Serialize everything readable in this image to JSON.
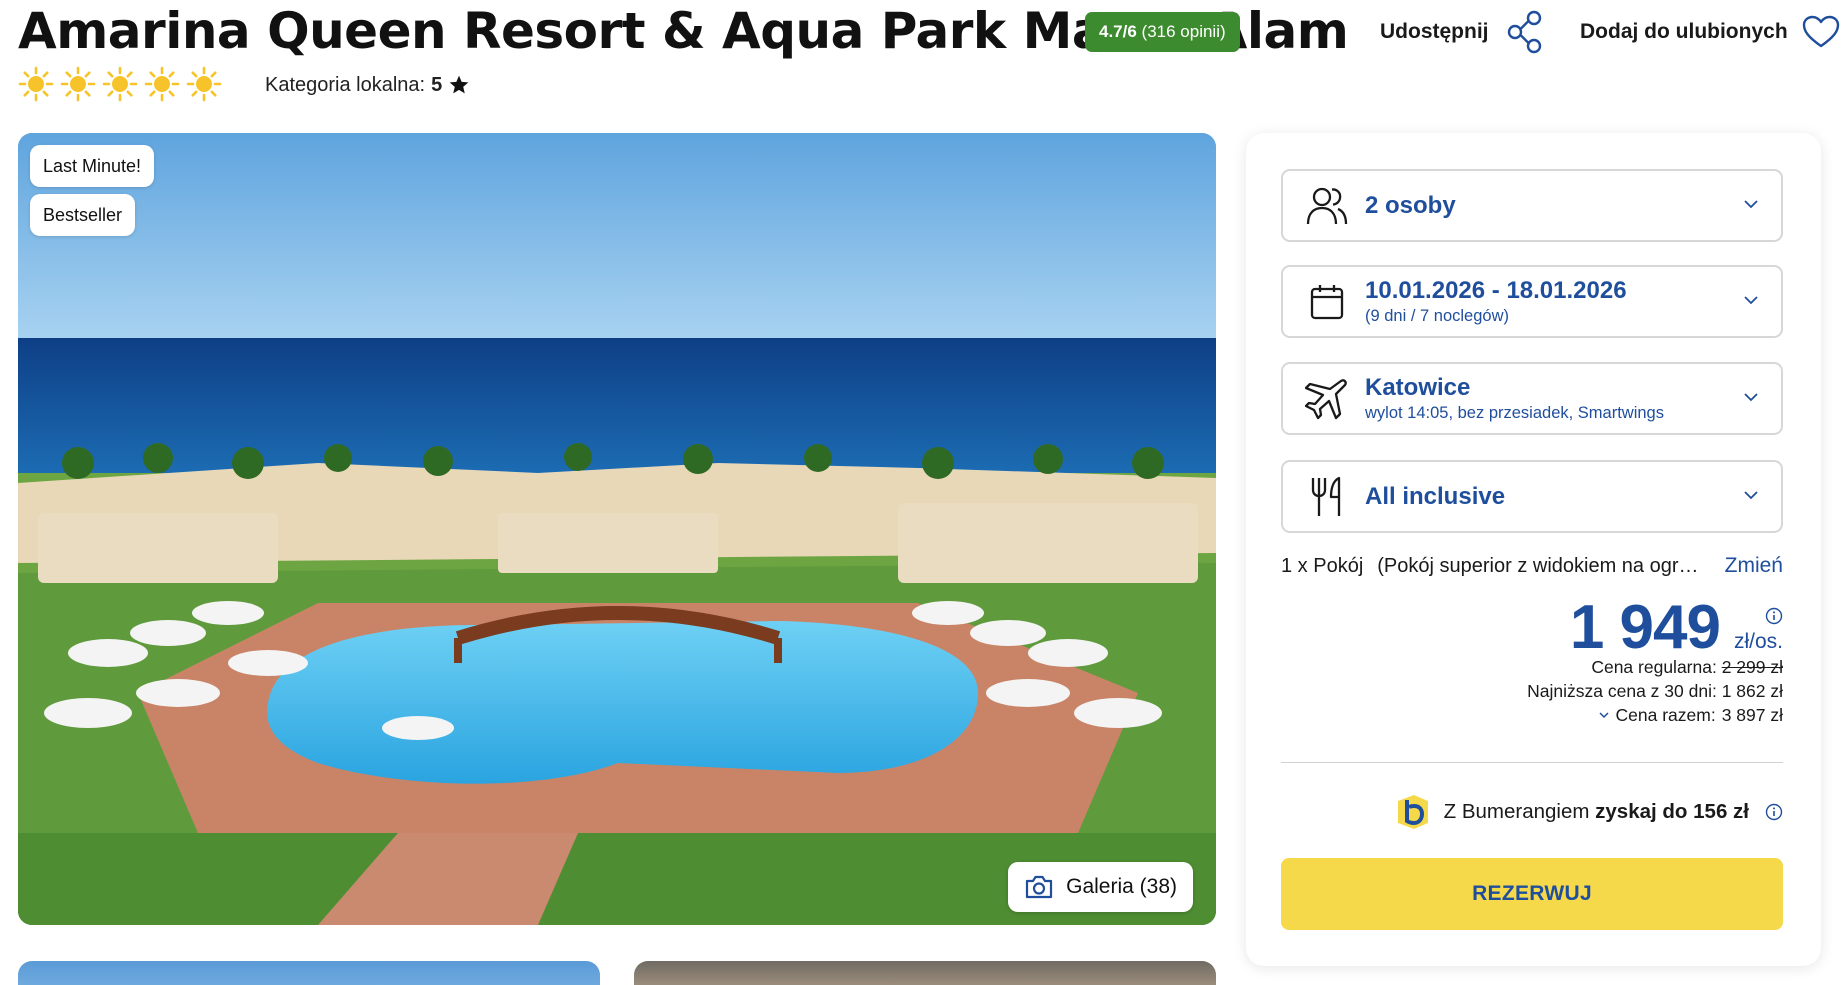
{
  "header": {
    "title": "Amarina Queen Resort & Aqua Park Marsa Alam",
    "rating_score": "4.7/6",
    "rating_reviews": "(316 opinii)",
    "share_label": "Udostępnij",
    "favorite_label": "Dodaj do ulubionych",
    "category_label": "Kategoria lokalna:",
    "category_value": "5",
    "suns_count": 5
  },
  "hero": {
    "tags": [
      "Last Minute!",
      "Bestseller"
    ],
    "gallery_label": "Galeria (38)"
  },
  "booking": {
    "travelers": {
      "main": "2 osoby",
      "icon": "people-icon"
    },
    "dates": {
      "main": "10.01.2026 - 18.01.2026",
      "sub": "(9 dni / 7 noclegów)",
      "icon": "calendar-icon"
    },
    "flight": {
      "main": "Katowice",
      "sub": "wylot 14:05, bez przesiadek, Smartwings",
      "icon": "plane-icon"
    },
    "board": {
      "main": "All inclusive",
      "icon": "cutlery-icon"
    },
    "room": {
      "count": "1 x Pokój",
      "type": "(Pokój superior z widokiem na ogród)",
      "change_label": "Zmień"
    },
    "price": {
      "amount": "1 949",
      "unit": "zł/os.",
      "regular_label": "Cena regularna:",
      "regular_value": "2 299 zł",
      "lowest_label": "Najniższa cena z 30 dni:",
      "lowest_value": "1 862 zł",
      "total_label": "Cena razem:",
      "total_value": "3 897 zł"
    },
    "boomerang": {
      "prefix": "Z Bumerangiem",
      "bold": "zyskaj do 156 zł"
    },
    "reserve_label": "REZERWUJ"
  },
  "colors": {
    "brand_blue": "#1f4e9c",
    "rating_green": "#3d8b2f",
    "reserve_yellow": "#f5d94a",
    "sun_yellow": "#f6c42a"
  }
}
